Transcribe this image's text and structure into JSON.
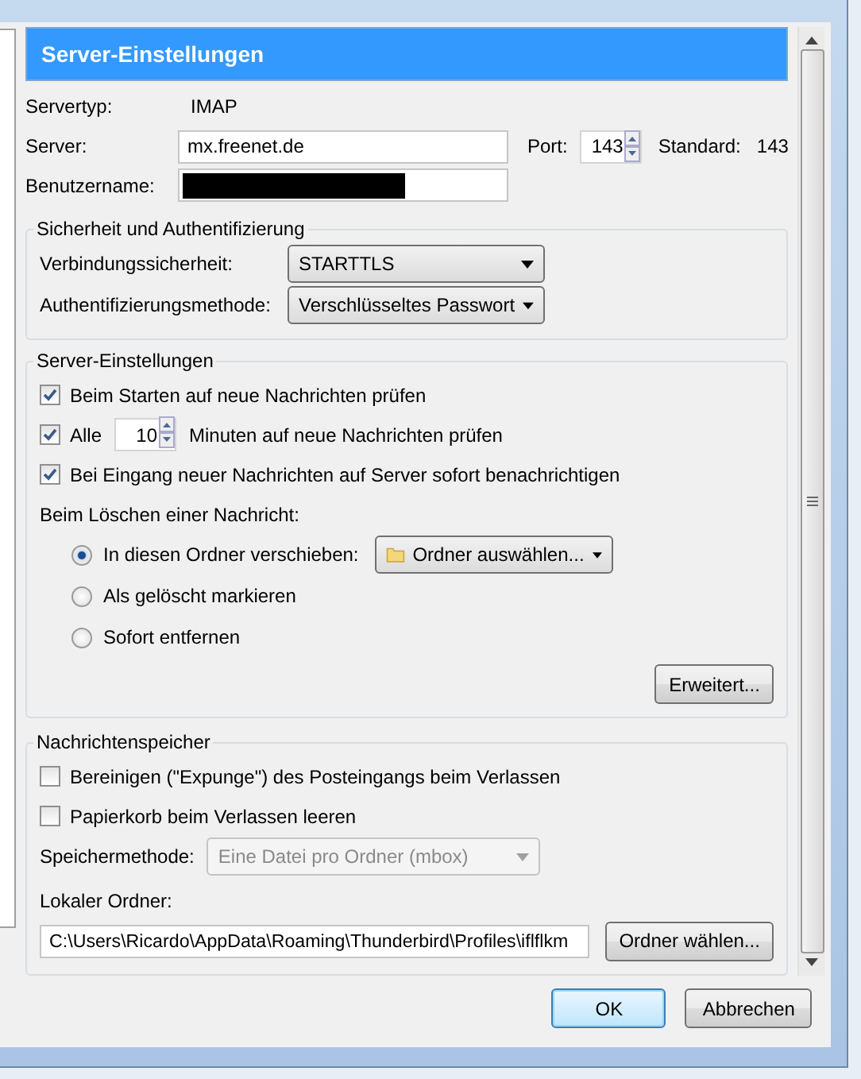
{
  "header": {
    "title": "Server-Einstellungen"
  },
  "server_type": {
    "label": "Servertyp:",
    "value": "IMAP"
  },
  "server": {
    "label": "Server:",
    "value": "mx.freenet.de"
  },
  "port": {
    "label": "Port:",
    "value": "143",
    "default_label": "Standard:",
    "default_value": "143"
  },
  "username": {
    "label": "Benutzername:",
    "redacted": true
  },
  "security": {
    "title": "Sicherheit und Authentifizierung",
    "rows": [
      {
        "label": "Verbindungssicherheit:",
        "value": "STARTTLS"
      },
      {
        "label": "Authentifizierungsmethode:",
        "value": "Verschlüsseltes Passwort"
      }
    ]
  },
  "server_settings": {
    "title": "Server-Einstellungen",
    "checks": [
      {
        "kind": "plain",
        "label": "Beim Starten auf neue Nachrichten prüfen",
        "checked": true
      },
      {
        "kind": "interval",
        "label": "Alle",
        "value": "10",
        "suffix": "Minuten auf neue Nachrichten prüfen",
        "checked": true
      },
      {
        "kind": "plain",
        "label": "Bei Eingang neuer Nachrichten auf Server sofort benachrichtigen",
        "checked": true
      }
    ],
    "delete_label": "Beim Löschen einer Nachricht:",
    "delete_options": [
      {
        "label": "In diesen Ordner verschieben:",
        "selected": true,
        "folder_picker": "Ordner auswählen..."
      },
      {
        "label": "Als gelöscht markieren",
        "selected": false
      },
      {
        "label": "Sofort entfernen",
        "selected": false
      }
    ],
    "advanced_button": "Erweitert..."
  },
  "storage": {
    "title": "Nachrichtenspeicher",
    "checks": [
      {
        "kind": "plain",
        "label": "Bereinigen (\"Expunge\") des Posteingangs beim Verlassen",
        "checked": false
      },
      {
        "kind": "plain",
        "label": "Papierkorb beim Verlassen leeren",
        "checked": false
      }
    ],
    "method": {
      "label": "Speichermethode:",
      "value": "Eine Datei pro Ordner (mbox)",
      "disabled": true
    },
    "local_folder": {
      "label": "Lokaler Ordner:",
      "value": "C:\\Users\\Ricardo\\AppData\\Roaming\\Thunderbird\\Profiles\\iflflkm",
      "button": "Ordner wählen..."
    }
  },
  "buttons": [
    {
      "label": "OK",
      "default": true
    },
    {
      "label": "Abbrechen",
      "default": false
    }
  ]
}
